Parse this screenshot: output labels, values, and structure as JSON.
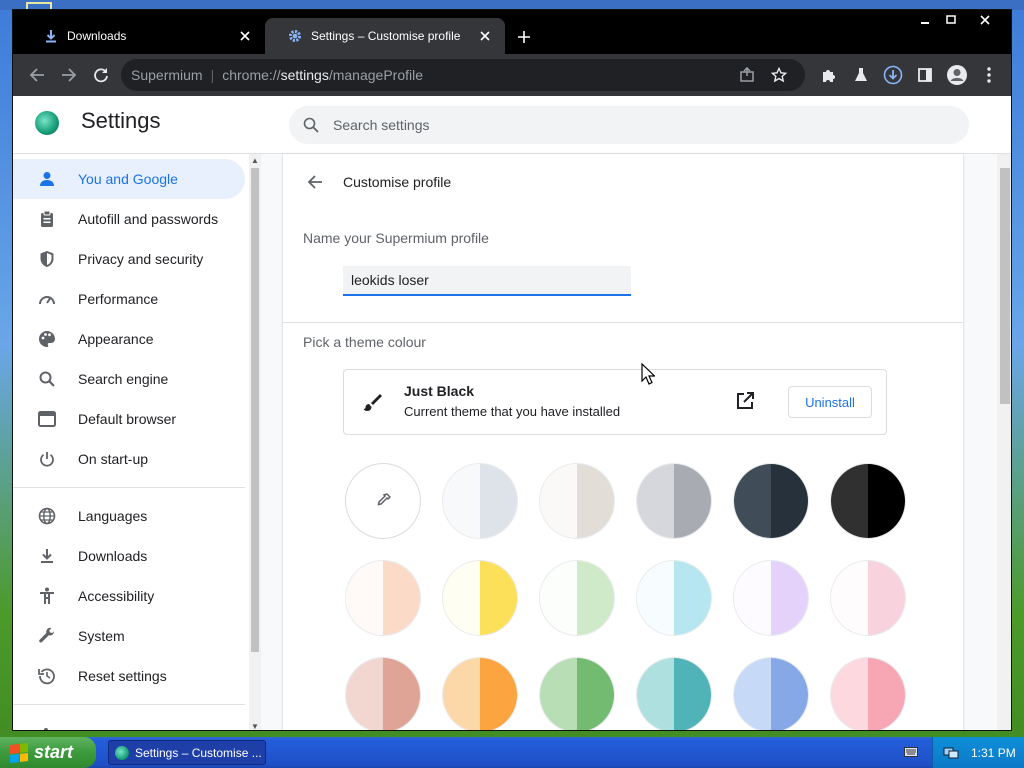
{
  "tabs": [
    {
      "title": "Downloads",
      "icon": "download-icon",
      "active": false
    },
    {
      "title": "Settings – Customise profile",
      "icon": "settings-gear-icon",
      "active": true
    }
  ],
  "omnibox": {
    "host": "Supermium",
    "url_prefix": "chrome://",
    "url_strong": "settings",
    "url_suffix": "/manageProfile"
  },
  "settings": {
    "title": "Settings",
    "search_placeholder": "Search settings"
  },
  "sidebar": {
    "items": [
      {
        "label": "You and Google",
        "icon": "person-icon",
        "active": true
      },
      {
        "label": "Autofill and passwords",
        "icon": "clipboard-icon"
      },
      {
        "label": "Privacy and security",
        "icon": "shield-icon"
      },
      {
        "label": "Performance",
        "icon": "speedometer-icon"
      },
      {
        "label": "Appearance",
        "icon": "palette-icon"
      },
      {
        "label": "Search engine",
        "icon": "search-icon"
      },
      {
        "label": "Default browser",
        "icon": "browser-window-icon"
      },
      {
        "label": "On start-up",
        "icon": "power-icon"
      },
      {
        "label": "Languages",
        "icon": "globe-icon"
      },
      {
        "label": "Downloads",
        "icon": "download-icon"
      },
      {
        "label": "Accessibility",
        "icon": "accessibility-icon"
      },
      {
        "label": "System",
        "icon": "wrench-icon"
      },
      {
        "label": "Reset settings",
        "icon": "reset-icon"
      }
    ]
  },
  "page": {
    "subpage_title": "Customise profile",
    "name_label": "Name your Supermium profile",
    "profile_name": "leokids loser",
    "theme_label": "Pick a theme colour",
    "theme_card": {
      "name": "Just Black",
      "description": "Current theme that you have installed",
      "button": "Uninstall"
    }
  },
  "swatches": [
    {
      "type": "custom"
    },
    {
      "left": "#f8f9fa",
      "right": "#dde3e8"
    },
    {
      "left": "#fbf9f8",
      "right": "#e3ddd8"
    },
    {
      "left": "#d5d7dc",
      "right": "#a8abb2"
    },
    {
      "left": "#404d58",
      "right": "#26313b"
    },
    {
      "left": "#303030",
      "right": "#000000"
    },
    {
      "left": "#fffaf7",
      "right": "#fcdac8"
    },
    {
      "left": "#fffef2",
      "right": "#fde05a"
    },
    {
      "left": "#fbfefb",
      "right": "#cfeac8"
    },
    {
      "left": "#f7fdfe",
      "right": "#b6e6ef"
    },
    {
      "left": "#fdfbff",
      "right": "#e4d2fb"
    },
    {
      "left": "#fffcfd",
      "right": "#f8d3dd"
    },
    {
      "left": "#f2d6d0",
      "right": "#dfa496"
    },
    {
      "left": "#fcd8a8",
      "right": "#fca43f"
    },
    {
      "left": "#b8deb6",
      "right": "#74bb72"
    },
    {
      "left": "#aee0e0",
      "right": "#4fb3b7"
    },
    {
      "left": "#c6d9f6",
      "right": "#86a8e6"
    },
    {
      "left": "#fdd8de",
      "right": "#f7a7b4"
    }
  ],
  "taskbar": {
    "start": "start",
    "task": "Settings – Customise ...",
    "clock": "1:31 PM"
  },
  "colors": {
    "accent": "#1a73e8",
    "tab_active": "#35363a",
    "toolbar": "#35363a"
  }
}
